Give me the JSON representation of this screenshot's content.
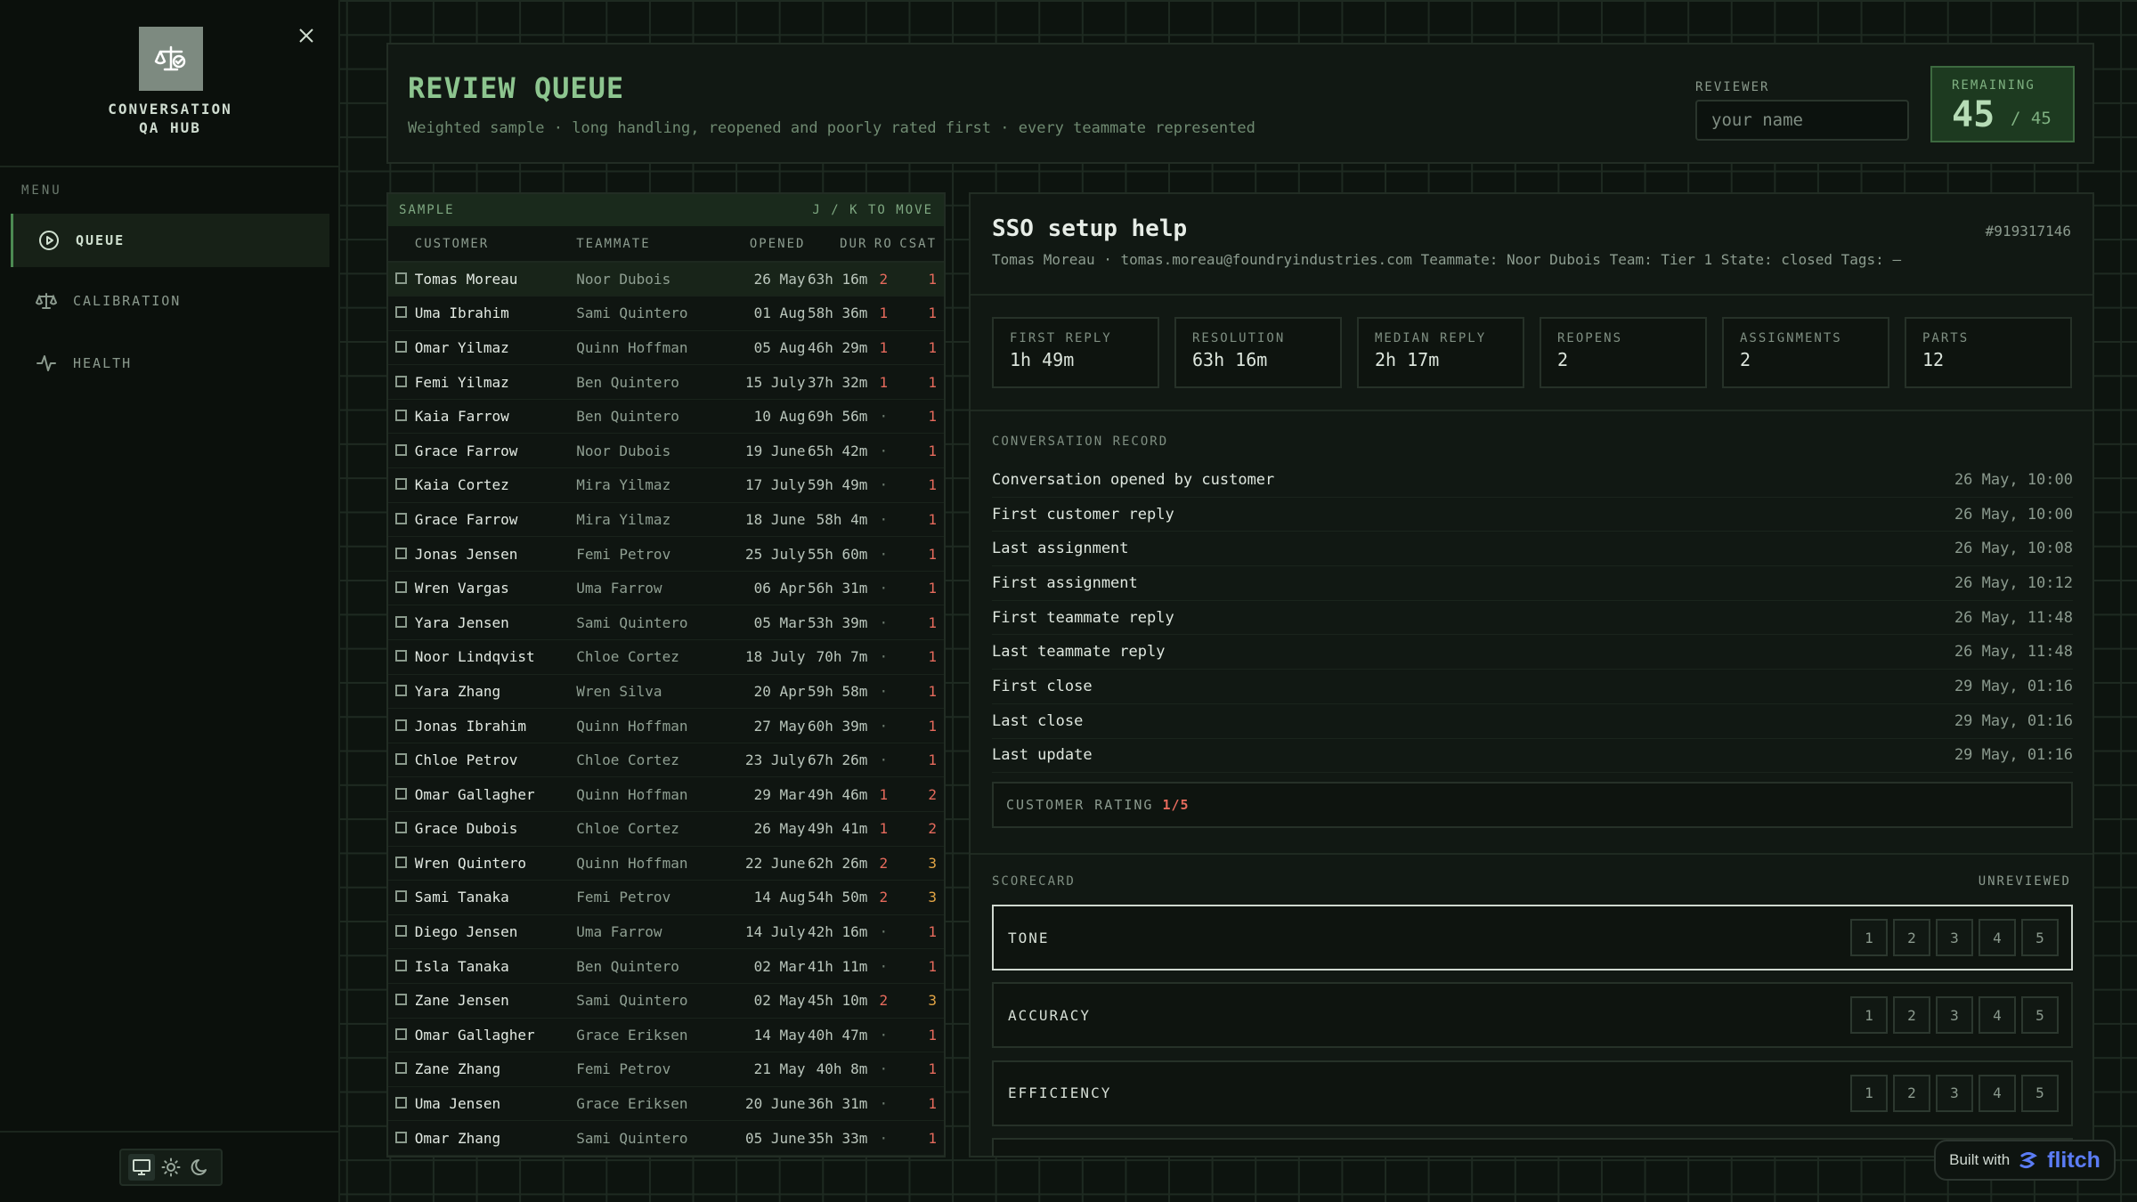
{
  "app": {
    "brand_line1": "CONVERSATION",
    "brand_line2": "QA HUB",
    "logo_icon": "scales-icon",
    "close_icon": "close-icon"
  },
  "sidebar": {
    "menu_label": "MENU",
    "items": [
      {
        "label": "QUEUE",
        "icon": "play-circle-icon",
        "active": true
      },
      {
        "label": "CALIBRATION",
        "icon": "scales-icon",
        "active": false
      },
      {
        "label": "HEALTH",
        "icon": "pulse-icon",
        "active": false
      }
    ],
    "theme_options": [
      "monitor-icon",
      "sun-icon",
      "moon-icon"
    ],
    "theme_active": "monitor-icon"
  },
  "header": {
    "title": "REVIEW QUEUE",
    "subtitle": "Weighted sample · long handling, reopened and poorly rated first · every teammate represented",
    "reviewer_label": "REVIEWER",
    "reviewer_value": "",
    "reviewer_placeholder": "your name",
    "remaining_label": "REMAINING",
    "remaining_count": "45",
    "remaining_total": "/ 45"
  },
  "sample": {
    "title": "SAMPLE",
    "hint": "J / K TO MOVE",
    "columns": [
      "CUSTOMER",
      "TEAMMATE",
      "OPENED",
      "DUR",
      "RO",
      "CSAT"
    ],
    "rows": [
      {
        "customer": "Tomas Moreau",
        "teammate": "Noor Dubois",
        "opened": "26 May",
        "dur": "63h 16m",
        "ro": "2",
        "csat": "1",
        "selected": true
      },
      {
        "customer": "Uma Ibrahim",
        "teammate": "Sami Quintero",
        "opened": "01 Aug",
        "dur": "58h 36m",
        "ro": "1",
        "csat": "1"
      },
      {
        "customer": "Omar Yilmaz",
        "teammate": "Quinn Hoffman",
        "opened": "05 Aug",
        "dur": "46h 29m",
        "ro": "1",
        "csat": "1"
      },
      {
        "customer": "Femi Yilmaz",
        "teammate": "Ben Quintero",
        "opened": "15 July",
        "dur": "37h 32m",
        "ro": "1",
        "csat": "1"
      },
      {
        "customer": "Kaia Farrow",
        "teammate": "Ben Quintero",
        "opened": "10 Aug",
        "dur": "69h 56m",
        "ro": "·",
        "csat": "1"
      },
      {
        "customer": "Grace Farrow",
        "teammate": "Noor Dubois",
        "opened": "19 June",
        "dur": "65h 42m",
        "ro": "·",
        "csat": "1"
      },
      {
        "customer": "Kaia Cortez",
        "teammate": "Mira Yilmaz",
        "opened": "17 July",
        "dur": "59h 49m",
        "ro": "·",
        "csat": "1"
      },
      {
        "customer": "Grace Farrow",
        "teammate": "Mira Yilmaz",
        "opened": "18 June",
        "dur": "58h 4m",
        "ro": "·",
        "csat": "1"
      },
      {
        "customer": "Jonas Jensen",
        "teammate": "Femi Petrov",
        "opened": "25 July",
        "dur": "55h 60m",
        "ro": "·",
        "csat": "1"
      },
      {
        "customer": "Wren Vargas",
        "teammate": "Uma Farrow",
        "opened": "06 Apr",
        "dur": "56h 31m",
        "ro": "·",
        "csat": "1"
      },
      {
        "customer": "Yara Jensen",
        "teammate": "Sami Quintero",
        "opened": "05 Mar",
        "dur": "53h 39m",
        "ro": "·",
        "csat": "1"
      },
      {
        "customer": "Noor Lindqvist",
        "teammate": "Chloe Cortez",
        "opened": "18 July",
        "dur": "70h 7m",
        "ro": "·",
        "csat": "1"
      },
      {
        "customer": "Yara Zhang",
        "teammate": "Wren Silva",
        "opened": "20 Apr",
        "dur": "59h 58m",
        "ro": "·",
        "csat": "1"
      },
      {
        "customer": "Jonas Ibrahim",
        "teammate": "Quinn Hoffman",
        "opened": "27 May",
        "dur": "60h 39m",
        "ro": "·",
        "csat": "1"
      },
      {
        "customer": "Chloe Petrov",
        "teammate": "Chloe Cortez",
        "opened": "23 July",
        "dur": "67h 26m",
        "ro": "·",
        "csat": "1"
      },
      {
        "customer": "Omar Gallagher",
        "teammate": "Quinn Hoffman",
        "opened": "29 Mar",
        "dur": "49h 46m",
        "ro": "1",
        "csat": "2"
      },
      {
        "customer": "Grace Dubois",
        "teammate": "Chloe Cortez",
        "opened": "26 May",
        "dur": "49h 41m",
        "ro": "1",
        "csat": "2"
      },
      {
        "customer": "Wren Quintero",
        "teammate": "Quinn Hoffman",
        "opened": "22 June",
        "dur": "62h 26m",
        "ro": "2",
        "csat": "3"
      },
      {
        "customer": "Sami Tanaka",
        "teammate": "Femi Petrov",
        "opened": "14 Aug",
        "dur": "54h 50m",
        "ro": "2",
        "csat": "3"
      },
      {
        "customer": "Diego Jensen",
        "teammate": "Uma Farrow",
        "opened": "14 July",
        "dur": "42h 16m",
        "ro": "·",
        "csat": "1"
      },
      {
        "customer": "Isla Tanaka",
        "teammate": "Ben Quintero",
        "opened": "02 Mar",
        "dur": "41h 11m",
        "ro": "·",
        "csat": "1"
      },
      {
        "customer": "Zane Jensen",
        "teammate": "Sami Quintero",
        "opened": "02 May",
        "dur": "45h 10m",
        "ro": "2",
        "csat": "3"
      },
      {
        "customer": "Omar Gallagher",
        "teammate": "Grace Eriksen",
        "opened": "14 May",
        "dur": "40h 47m",
        "ro": "·",
        "csat": "1"
      },
      {
        "customer": "Zane Zhang",
        "teammate": "Femi Petrov",
        "opened": "21 May",
        "dur": "40h 8m",
        "ro": "·",
        "csat": "1"
      },
      {
        "customer": "Uma Jensen",
        "teammate": "Grace Eriksen",
        "opened": "20 June",
        "dur": "36h 31m",
        "ro": "·",
        "csat": "1"
      },
      {
        "customer": "Omar Zhang",
        "teammate": "Sami Quintero",
        "opened": "05 June",
        "dur": "35h 33m",
        "ro": "·",
        "csat": "1"
      }
    ]
  },
  "detail": {
    "title": "SSO setup help",
    "id": "#919317146",
    "meta": "Tomas Moreau · tomas.moreau@foundryindustries.com   Teammate: Noor Dubois   Team: Tier 1   State: closed   Tags: —",
    "metrics": [
      {
        "label": "FIRST REPLY",
        "value": "1h 49m"
      },
      {
        "label": "RESOLUTION",
        "value": "63h 16m"
      },
      {
        "label": "MEDIAN REPLY",
        "value": "2h 17m"
      },
      {
        "label": "REOPENS",
        "value": "2"
      },
      {
        "label": "ASSIGNMENTS",
        "value": "2"
      },
      {
        "label": "PARTS",
        "value": "12"
      }
    ],
    "record_label": "CONVERSATION RECORD",
    "record": [
      {
        "label": "Conversation opened by customer",
        "time": "26 May, 10:00"
      },
      {
        "label": "First customer reply",
        "time": "26 May, 10:00"
      },
      {
        "label": "Last assignment",
        "time": "26 May, 10:08"
      },
      {
        "label": "First assignment",
        "time": "26 May, 10:12"
      },
      {
        "label": "First teammate reply",
        "time": "26 May, 11:48"
      },
      {
        "label": "Last teammate reply",
        "time": "26 May, 11:48"
      },
      {
        "label": "First close",
        "time": "29 May, 01:16"
      },
      {
        "label": "Last close",
        "time": "29 May, 01:16"
      },
      {
        "label": "Last update",
        "time": "29 May, 01:16"
      }
    ],
    "rating_label": "CUSTOMER RATING",
    "rating_value": "1/5",
    "scorecard_label": "SCORECARD",
    "scorecard_status": "UNREVIEWED",
    "scorecard": [
      {
        "name": "TONE",
        "active": true
      },
      {
        "name": "ACCURACY",
        "active": false
      },
      {
        "name": "EFFICIENCY",
        "active": false
      }
    ],
    "score_options": [
      "1",
      "2",
      "3",
      "4",
      "5"
    ]
  },
  "badge": {
    "built_with": "Built with",
    "brand": "flitch"
  },
  "colors": {
    "accent_green": "#8dc58f",
    "danger_red": "#e56a5c",
    "warn_orange": "#e3a545",
    "flitch_blue": "#5b7cf5"
  }
}
